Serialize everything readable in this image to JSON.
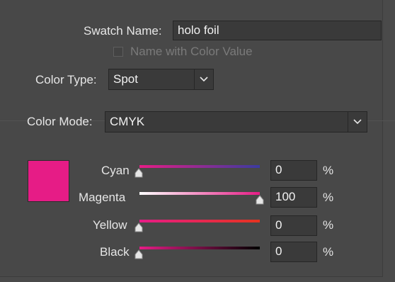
{
  "swatch_name": {
    "label": "Swatch Name:",
    "value": "holo foil"
  },
  "name_with_color_value": {
    "label": "Name with Color Value",
    "checked": false
  },
  "color_type": {
    "label": "Color Type:",
    "value": "Spot"
  },
  "color_mode": {
    "label": "Color Mode:",
    "value": "CMYK"
  },
  "swatch_color": "#e61c86",
  "channels": [
    {
      "label": "Cyan",
      "value": "0",
      "unit": "%",
      "gradient": [
        "#e61c86",
        "#3b3ba0"
      ]
    },
    {
      "label": "Magenta",
      "value": "100",
      "unit": "%",
      "gradient": [
        "#ffffff",
        "#e61c86"
      ]
    },
    {
      "label": "Yellow",
      "value": "0",
      "unit": "%",
      "gradient": [
        "#e61c86",
        "#e6331f"
      ]
    },
    {
      "label": "Black",
      "value": "0",
      "unit": "%",
      "gradient": [
        "#e61c86",
        "#000000"
      ]
    }
  ],
  "icons": {
    "dropdown": "chevron-down-icon",
    "slider_thumb": "triangle-up-icon"
  }
}
